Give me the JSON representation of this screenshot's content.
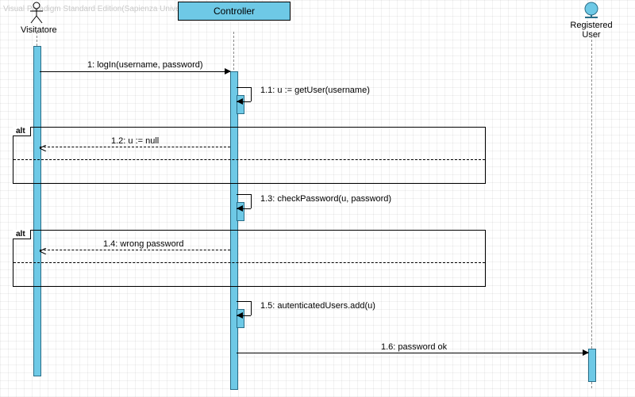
{
  "watermark": "Visual Paradigm Standard Edition(Sapienza University of Rome)",
  "lifelines": {
    "visitor": {
      "label": "Visitatore"
    },
    "controller": {
      "label": "Controller"
    },
    "registered": {
      "label": "Registered User"
    }
  },
  "messages": {
    "m1": {
      "label": "1: logIn(username, password)"
    },
    "m11": {
      "label": "1.1: u := getUser(username)"
    },
    "m12": {
      "label": "1.2: u := null"
    },
    "m13": {
      "label": "1.3: checkPassword(u, password)"
    },
    "m14": {
      "label": "1.4: wrong password"
    },
    "m15": {
      "label": "1.5: autenticatedUsers.add(u)"
    },
    "m16": {
      "label": "1.6: password ok"
    }
  },
  "fragments": {
    "alt1": {
      "operator": "alt"
    },
    "alt2": {
      "operator": "alt"
    }
  }
}
